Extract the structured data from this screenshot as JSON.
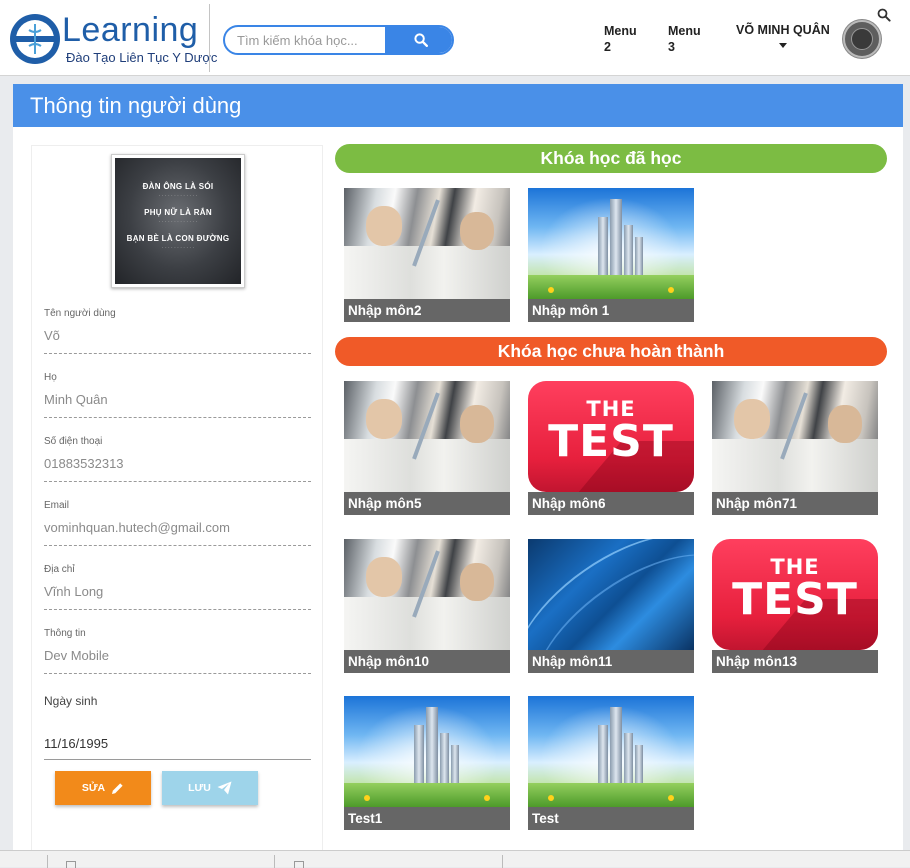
{
  "header": {
    "logo_word": "Learning",
    "logo_sub": "Đào Tạo Liên Tục Y Dược",
    "search_placeholder": "Tìm kiếm khóa học...",
    "menus": [
      {
        "label_line1": "Menu",
        "label_line2": "2"
      },
      {
        "label_line1": "Menu",
        "label_line2": "3"
      }
    ],
    "user_name": "VÕ MINH QUÂN"
  },
  "page_title": "Thông tin người dùng",
  "profile": {
    "photo_lines": [
      "ĐÀN ÔNG LÀ SÓI",
      "PHỤ NỮ LÀ RẮN",
      "BẠN BÈ LÀ CON ĐƯỜNG"
    ],
    "fields": [
      {
        "label": "Tên người dùng",
        "value": "Võ"
      },
      {
        "label": "Họ",
        "value": "Minh Quân"
      },
      {
        "label": "Số điện thoại",
        "value": "01883532313"
      },
      {
        "label": "Email",
        "value": "vominhquan.hutech@gmail.com"
      },
      {
        "label": "Địa chỉ",
        "value": "Vĩnh Long"
      },
      {
        "label": "Thông tin",
        "value": "Dev Mobile"
      }
    ],
    "birthday_label": "Ngày sinh",
    "birthday_value": "11/16/1995",
    "edit_label": "SỬA",
    "save_label": "LƯU"
  },
  "courses": {
    "completed_title": "Khóa học đã học",
    "incomplete_title": "Khóa học chưa hoàn thành",
    "completed": [
      {
        "name": "Nhập môn2",
        "thumb": "lab"
      },
      {
        "name": "Nhập môn 1",
        "thumb": "city"
      }
    ],
    "incomplete": [
      {
        "name": "Nhập môn5",
        "thumb": "lab"
      },
      {
        "name": "Nhập môn6",
        "thumb": "test"
      },
      {
        "name": "Nhập môn71",
        "thumb": "lab"
      },
      {
        "name": "Nhập môn10",
        "thumb": "lab"
      },
      {
        "name": "Nhập môn11",
        "thumb": "blue"
      },
      {
        "name": "Nhập môn13",
        "thumb": "test"
      },
      {
        "name": "Test1",
        "thumb": "city"
      },
      {
        "name": "Test",
        "thumb": "city"
      }
    ],
    "test_badge_small": "THE",
    "test_badge_big": "TEST"
  },
  "colors": {
    "primary": "#4a90e8",
    "completed_bar": "#7cbc43",
    "incomplete_bar": "#f05a28",
    "edit_button": "#f28a1a",
    "save_button": "#9ed4ea"
  }
}
